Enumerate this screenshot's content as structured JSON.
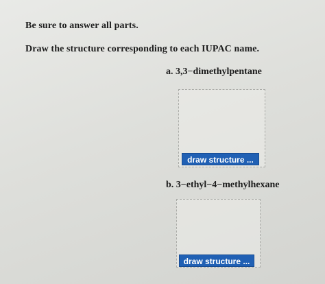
{
  "instructions": {
    "line1": "Be sure to answer all parts.",
    "line2": "Draw the structure corresponding to each IUPAC name."
  },
  "parts": [
    {
      "label": "a. 3,3−dimethylpentane",
      "button_label": "draw structure ..."
    },
    {
      "label": "b. 3−ethyl−4−methylhexane",
      "button_label": "draw structure ..."
    }
  ],
  "colors": {
    "button_bg": "#2060b4",
    "button_text": "#ffffff",
    "page_bg": "#e2e3df"
  }
}
